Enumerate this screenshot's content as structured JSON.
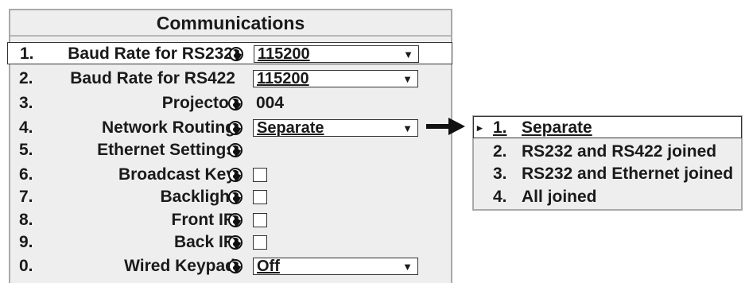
{
  "menu": {
    "title": "Communications",
    "rows": [
      {
        "num": "1.",
        "label": "Baud Rate for RS232",
        "globe": true,
        "control": "dropdown",
        "value": "115200",
        "selected": true
      },
      {
        "num": "2.",
        "label": "Baud Rate for RS422",
        "globe": false,
        "control": "dropdown",
        "value": "115200"
      },
      {
        "num": "3.",
        "label": "Projector",
        "globe": true,
        "control": "text",
        "value": "004"
      },
      {
        "num": "4.",
        "label": "Network Routing",
        "globe": true,
        "control": "dropdown",
        "value": "Separate"
      },
      {
        "num": "5.",
        "label": "Ethernet Settings",
        "globe": true,
        "control": "none"
      },
      {
        "num": "6.",
        "label": "Broadcast Key",
        "globe": true,
        "control": "checkbox",
        "checked": false
      },
      {
        "num": "7.",
        "label": "Backlight",
        "globe": true,
        "control": "checkbox",
        "checked": false
      },
      {
        "num": "8.",
        "label": "Front IR",
        "globe": true,
        "control": "checkbox",
        "checked": false
      },
      {
        "num": "9.",
        "label": "Back IR",
        "globe": true,
        "control": "checkbox",
        "checked": false
      },
      {
        "num": "0.",
        "label": "Wired Keypad",
        "globe": true,
        "control": "dropdown",
        "value": "Off"
      }
    ]
  },
  "popup": {
    "pointer": "▸",
    "items": [
      {
        "num": "1.",
        "label": "Separate",
        "selected": true
      },
      {
        "num": "2.",
        "label": "RS232 and RS422 joined"
      },
      {
        "num": "3.",
        "label": "RS232 and Ethernet joined"
      },
      {
        "num": "4.",
        "label": "All joined"
      }
    ]
  },
  "icons": {
    "globe": "globe-icon",
    "dropdown_arrow": "dropdown-arrow-icon",
    "pointer_arrow": "right-arrow-icon"
  },
  "dropdown_arrow_glyph": "▼",
  "colors": {
    "panel": "#eeeeee",
    "border": "#a9a9a9",
    "text": "#1a1a1a",
    "highlight": "#ffffff"
  }
}
